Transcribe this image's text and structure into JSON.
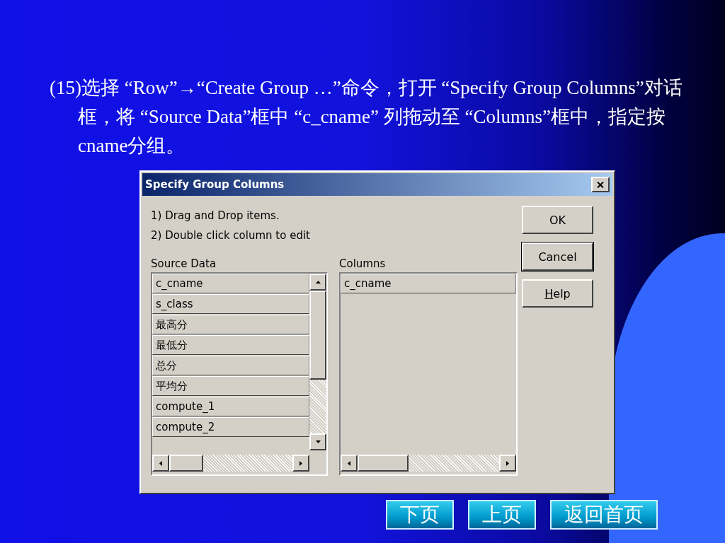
{
  "slide": {
    "text": "(15)选择 “Row”→“Create Group …”命令，打开 “Specify Group Columns”对话框，将 “Source Data”框中 “c_cname” 列拖动至 “Columns”框中，指定按cname分组。"
  },
  "dialog": {
    "title": "Specify Group Columns",
    "instructions": [
      "1) Drag and Drop items.",
      "2) Double click column to edit"
    ],
    "source_label": "Source Data",
    "source_items": [
      "c_cname",
      "s_class",
      "最高分",
      "最低分",
      "总分",
      "平均分",
      "compute_1",
      "compute_2"
    ],
    "columns_label": "Columns",
    "column_items": [
      "c_cname"
    ],
    "buttons": [
      {
        "label": "OK",
        "default": false,
        "accelerator": false
      },
      {
        "label": "Cancel",
        "default": true,
        "accelerator": false
      },
      {
        "label": "Help",
        "default": false,
        "accelerator": true
      }
    ]
  },
  "nav": [
    "下页",
    "上页",
    "返回首页"
  ]
}
